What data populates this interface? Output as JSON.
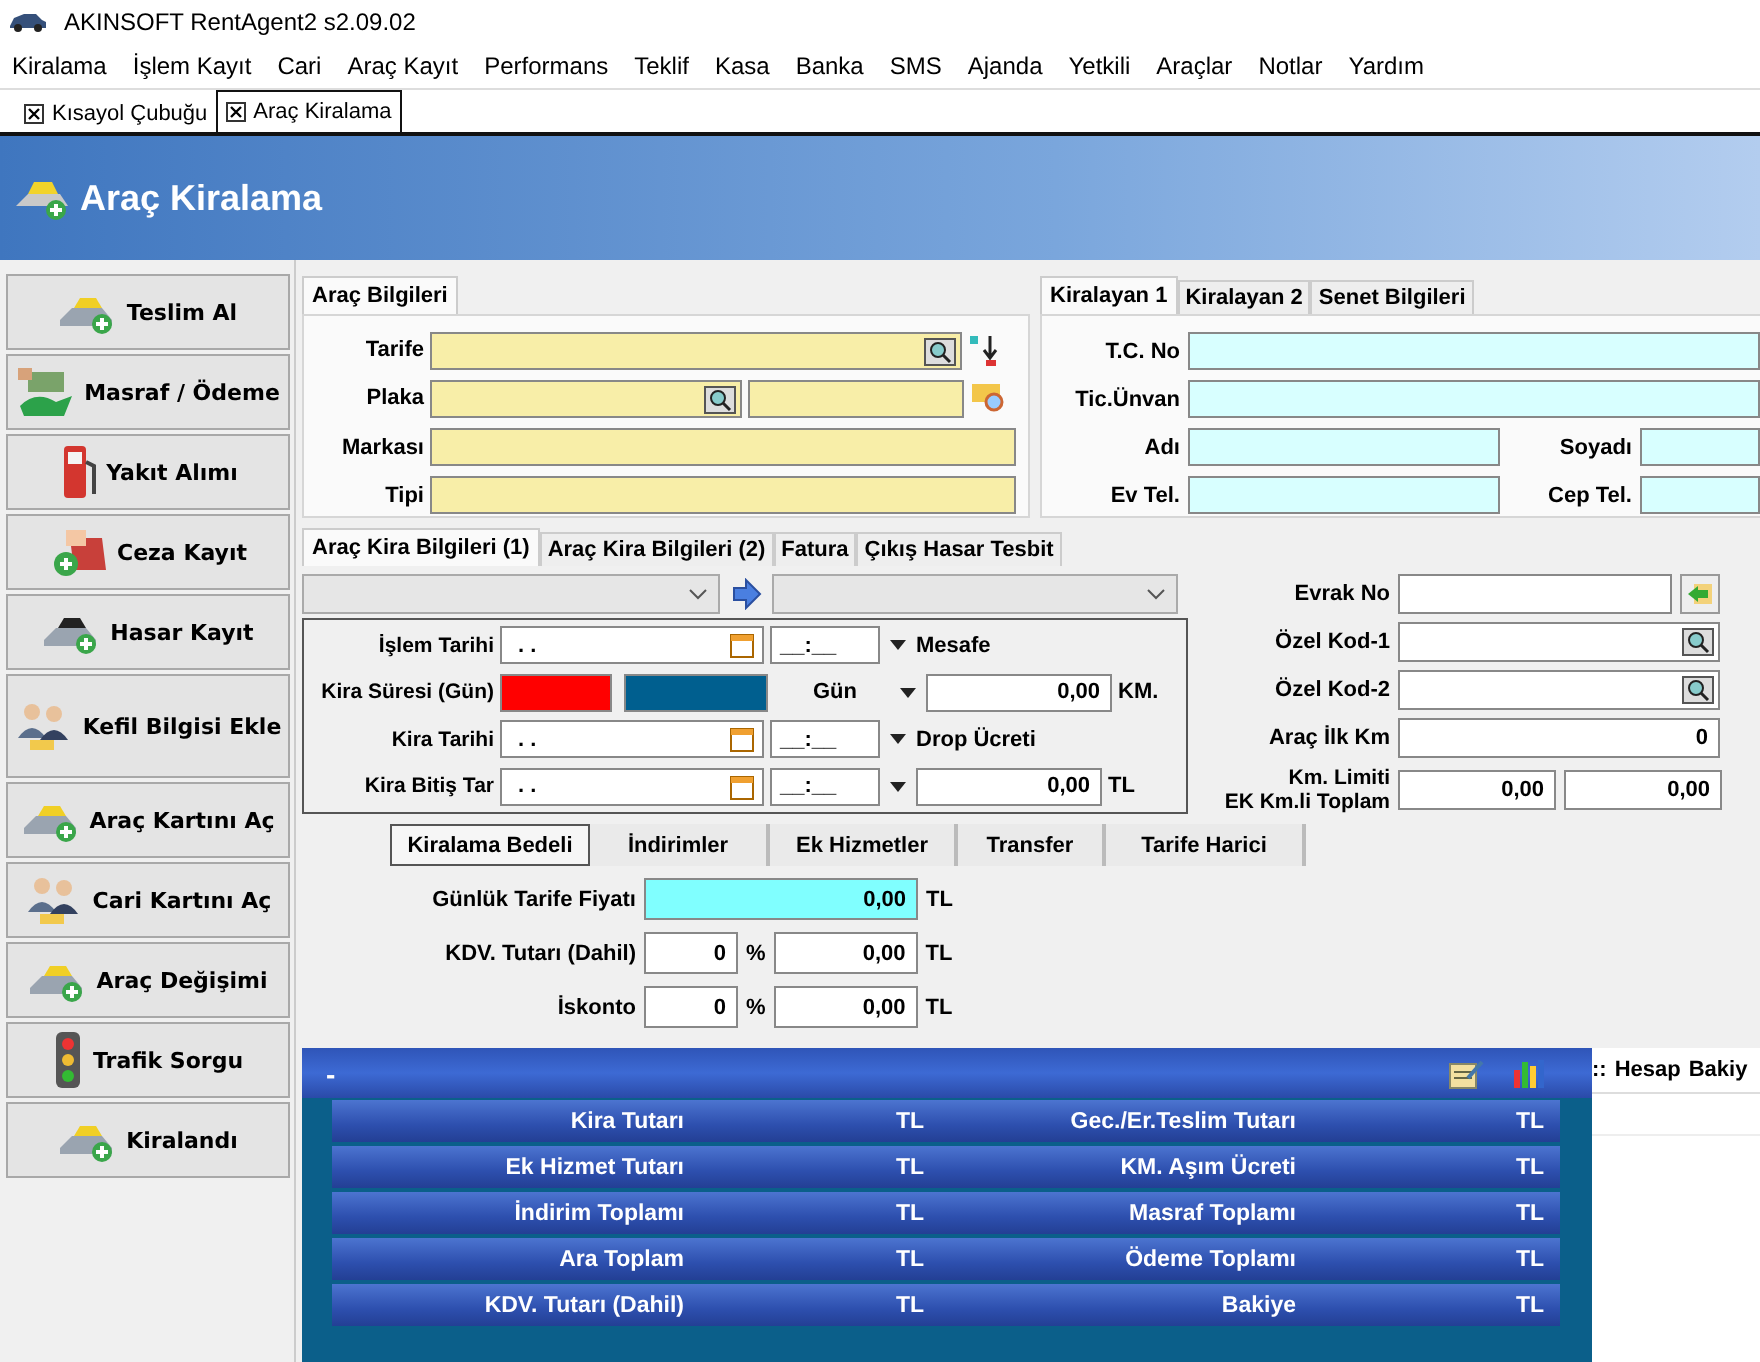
{
  "window": {
    "title": "AKINSOFT RentAgent2 s2.09.02"
  },
  "menu": [
    "Kiralama",
    "İşlem Kayıt",
    "Cari",
    "Araç Kayıt",
    "Performans",
    "Teklif",
    "Kasa",
    "Banka",
    "SMS",
    "Ajanda",
    "Yetkili",
    "Araçlar",
    "Notlar",
    "Yardım"
  ],
  "doc_tabs": [
    {
      "label": "Kısayol Çubuğu",
      "selected": false
    },
    {
      "label": "Araç Kiralama",
      "selected": true
    }
  ],
  "header": {
    "title": "Araç Kiralama"
  },
  "sidebar": [
    "Teslim Al",
    "Masraf / Ödeme",
    "Yakıt Alımı",
    "Ceza Kayıt",
    "Hasar Kayıt",
    "Kefil Bilgisi Ekle",
    "Araç Kartını Aç",
    "Cari Kartını Aç",
    "Araç Değişimi",
    "Trafik Sorgu",
    "Kiralandı"
  ],
  "vehicle_panel": {
    "tabs": [
      {
        "label": "Araç Bilgileri",
        "selected": true
      }
    ],
    "fields": [
      "Tarife",
      "Plaka",
      "Markası",
      "Tipi"
    ]
  },
  "renter_panel": {
    "tabs": [
      {
        "label": "Kiralayan 1",
        "selected": true
      },
      {
        "label": "Kiralayan 2",
        "selected": false
      },
      {
        "label": "Senet Bilgileri",
        "selected": false
      }
    ],
    "fields": [
      "T.C. No",
      "Tic.Ünvan",
      "Adı",
      "Soyadı",
      "Ev Tel.",
      "Cep Tel."
    ]
  },
  "rental_tabs": [
    {
      "label": "Araç Kira Bilgileri (1)",
      "selected": true
    },
    {
      "label": "Araç Kira Bilgileri (2)",
      "selected": false
    },
    {
      "label": "Fatura",
      "selected": false
    },
    {
      "label": "Çıkış Hasar Tesbit",
      "selected": false
    }
  ],
  "rental_form": {
    "islem_tarihi": {
      "label": "İşlem Tarihi",
      "date": ". .",
      "time": "__:__"
    },
    "mesafe_label": "Mesafe",
    "kira_suresi": {
      "label": "Kira Süresi (Gün)",
      "unit_select": "Gün",
      "value": "0,00",
      "unit": "KM."
    },
    "kira_tarihi": {
      "label": "Kira Tarihi",
      "date": ". .",
      "time": "__:__"
    },
    "drop_label": "Drop Ücreti",
    "kira_bitis": {
      "label": "Kira Bitiş Tar",
      "date": ". .",
      "time": "__:__",
      "value": "0,00",
      "unit": "TL"
    }
  },
  "documents": {
    "evrak_no": "Evrak No",
    "ozel_kod_1": "Özel Kod-1",
    "ozel_kod_2": "Özel Kod-2",
    "ilk_km": {
      "label": "Araç İlk Km",
      "value": "0"
    },
    "km_limit": {
      "label_1": "Km. Limiti",
      "label_2": "EK Km.li Toplam",
      "value_1": "0,00",
      "value_2": "0,00"
    }
  },
  "price_tabs": [
    {
      "label": "Kiralama Bedeli",
      "selected": true
    },
    {
      "label": "İndirimler",
      "selected": false
    },
    {
      "label": "Ek Hizmetler",
      "selected": false
    },
    {
      "label": "Transfer",
      "selected": false
    },
    {
      "label": "Tarife Harici",
      "selected": false
    }
  ],
  "price": {
    "daily": {
      "label": "Günlük Tarife Fiyatı",
      "value": "0,00",
      "unit": "TL"
    },
    "vat": {
      "label": "KDV. Tutarı (Dahil)",
      "rate": "0",
      "percent": "%",
      "value": "0,00",
      "unit": "TL"
    },
    "discount": {
      "label": "İskonto",
      "rate": "0",
      "percent": "%",
      "value": "0,00",
      "unit": "TL"
    }
  },
  "summary": {
    "collapse": "-",
    "rows": [
      {
        "left": "Kira Tutarı",
        "left_unit": "TL",
        "right": "Gec./Er.Teslim Tutarı",
        "right_unit": "TL"
      },
      {
        "left": "Ek Hizmet Tutarı",
        "left_unit": "TL",
        "right": "KM. Aşım Ücreti",
        "right_unit": "TL"
      },
      {
        "left": "İndirim Toplamı",
        "left_unit": "TL",
        "right": "Masraf Toplamı",
        "right_unit": "TL"
      },
      {
        "left": "Ara Toplam",
        "left_unit": "TL",
        "right": "Ödeme Toplamı",
        "right_unit": "TL"
      },
      {
        "left": "KDV. Tutarı (Dahil)",
        "left_unit": "TL",
        "right": "Bakiye",
        "right_unit": "TL"
      }
    ]
  },
  "account_grid": {
    "columns": [
      "::",
      "Hesap",
      "Bakiy"
    ]
  }
}
